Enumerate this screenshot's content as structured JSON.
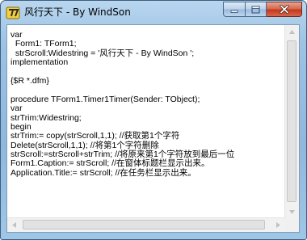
{
  "window": {
    "title": "风行天下 - By WindSon",
    "icon": "delphi-app-icon"
  },
  "titlebar": {
    "minimize_icon": "minimize-icon",
    "maximize_icon": "maximize-icon",
    "close_icon": "close-icon"
  },
  "editor": {
    "lines": [
      "var",
      "  Form1: TForm1;",
      "  strScroll:Widestring = '风行天下 - By WindSon ';",
      "implementation",
      "",
      "{$R *.dfm}",
      "",
      "procedure TForm1.Timer1Timer(Sender: TObject);",
      "var",
      "strTrim:Widestring;",
      "begin",
      "strTrim:= copy(strScroll,1,1); //获取第1个字符",
      "Delete(strScroll,1,1); //将第1个字符删除",
      "strScroll:=strScroll+strTrim; //将原来第1个字符放到最后一位",
      "Form1.Caption:= strScroll; //在窗体标题栏显示出来。",
      "Application.Title:= strScroll; //在任务栏显示出来。"
    ]
  },
  "colors": {
    "frame": "#9cc3e4",
    "close_button": "#c4391c",
    "text": "#000000",
    "background": "#ffffff"
  }
}
